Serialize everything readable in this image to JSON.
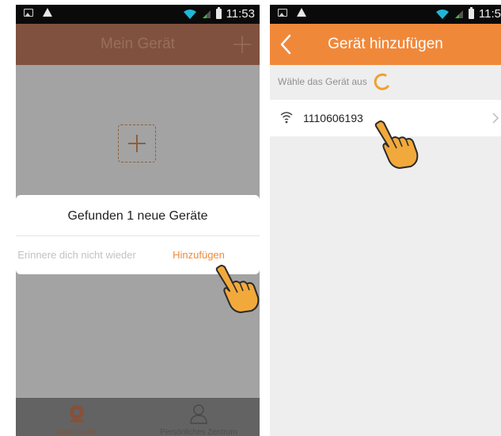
{
  "left_screen": {
    "status_bar": {
      "time": "11:53"
    },
    "app_bar": {
      "title": "Mein Gerät"
    },
    "dialog": {
      "message": "Gefunden 1 neue Geräte",
      "dismiss_label": "Erinnere dich nicht wieder",
      "confirm_label": "Hinzufügen"
    },
    "tabs": [
      {
        "label": "Mein Gerät",
        "icon": "camera-icon",
        "active": true
      },
      {
        "label": "Persönliches Zentrum",
        "icon": "person-icon",
        "active": false
      }
    ]
  },
  "right_screen": {
    "status_bar": {
      "time": "11:5"
    },
    "app_bar": {
      "title": "Gerät hinzufügen"
    },
    "hint": "Wähle das Gerät aus",
    "devices": [
      {
        "id": "1110606193",
        "icon": "wifi-icon"
      }
    ]
  },
  "colors": {
    "accent": "#f0883a",
    "accent_dimmed": "#b05a3a",
    "status_bar": "#0a0a0a",
    "overlay": "#7b7b7b"
  }
}
